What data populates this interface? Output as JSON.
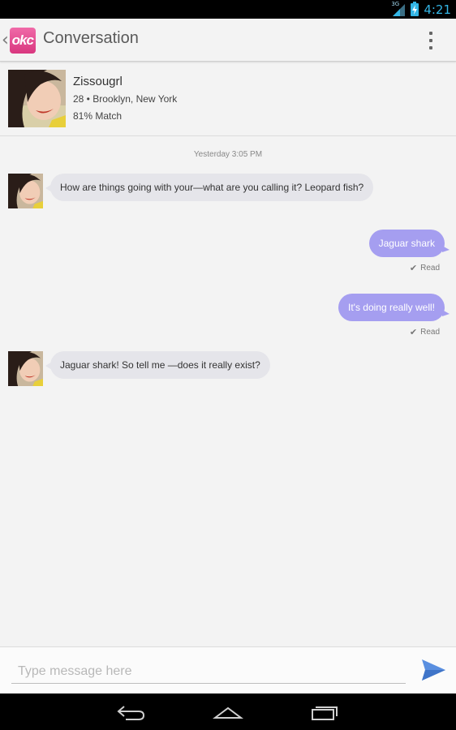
{
  "status_bar": {
    "network_label": "3G",
    "time": "4:21",
    "icons": [
      "signal-icon",
      "battery-charging-icon"
    ]
  },
  "action_bar": {
    "logo_text": "okc",
    "title": "Conversation",
    "icons": [
      "back-chevron-icon",
      "overflow-menu-icon"
    ],
    "brand_color": "#e0468c"
  },
  "profile": {
    "name": "Zissougrl",
    "age_location": "28 • Brooklyn, New York",
    "match": "81% Match"
  },
  "conversation": {
    "timestamp": "Yesterday 3:05 PM",
    "messages": [
      {
        "from": "them",
        "text": "How are things going with your—what are you calling it? Leopard fish?"
      },
      {
        "from": "me",
        "text": "Jaguar shark",
        "status": "Read"
      },
      {
        "from": "me",
        "text": "It's doing really well!",
        "status": "Read"
      },
      {
        "from": "them",
        "text": "Jaguar shark! So tell me —does it really exist?"
      }
    ],
    "outgoing_color": "#a59ef0",
    "incoming_color": "#e5e5ea"
  },
  "composer": {
    "placeholder": "Type message here",
    "value": "",
    "send_icon": "send-icon",
    "send_color": "#5a8fe0"
  },
  "nav_bar": {
    "icons": [
      "back-icon",
      "home-icon",
      "recent-apps-icon"
    ]
  }
}
